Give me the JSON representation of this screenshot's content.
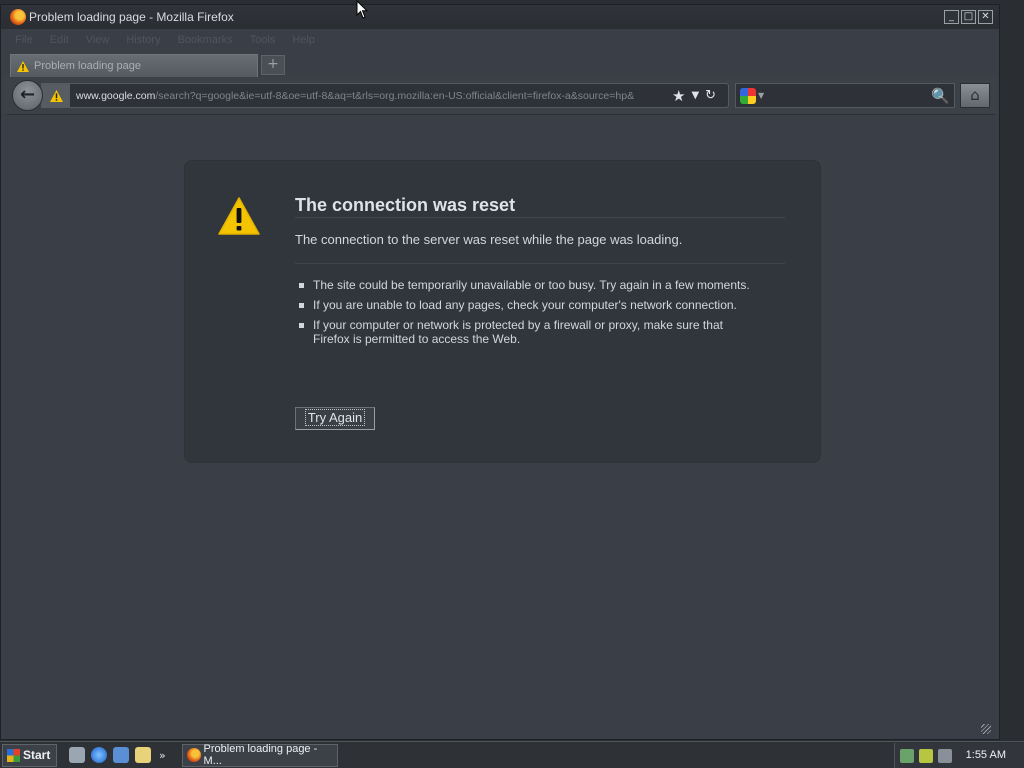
{
  "window": {
    "title": "Problem loading page - Mozilla Firefox",
    "minimize": "_",
    "maximize": "□",
    "close": "✕"
  },
  "menu": [
    "File",
    "Edit",
    "View",
    "History",
    "Bookmarks",
    "Tools",
    "Help"
  ],
  "tab": {
    "label": "Problem loading page",
    "new_tab": "+"
  },
  "nav": {
    "url_domain": "www.google.com",
    "url_rest": "/search?q=google&ie=utf-8&oe=utf-8&aq=t&rls=org.mozilla:en-US:official&client=firefox-a&source=hp&",
    "search_placeholder": ""
  },
  "error": {
    "title": "The connection was reset",
    "description": "The connection to the server was reset while the page was loading.",
    "bullets": [
      "The site could be temporarily unavailable or too busy. Try again in a few moments.",
      "If you are unable to load any pages, check your computer's network connection.",
      "If your computer or network is protected by a firewall or proxy, make sure that Firefox is permitted to access the Web."
    ],
    "try_again": "Try Again"
  },
  "taskbar": {
    "start": "Start",
    "task_label": "Problem loading page - M...",
    "quick_launch_more": "»",
    "clock": "1:55 AM"
  },
  "colors": {
    "window_bg": "#3a3f47",
    "error_box_bg": "#31363d",
    "warning_yellow": "#f5c400"
  }
}
